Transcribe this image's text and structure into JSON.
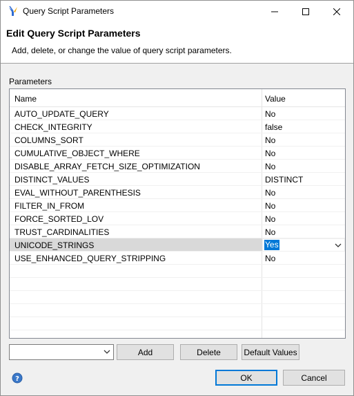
{
  "window": {
    "title": "Query Script Parameters",
    "icon": "app-logo-icon",
    "controls": [
      "minimize-icon",
      "maximize-icon",
      "close-icon"
    ]
  },
  "header": {
    "title": "Edit Query Script Parameters",
    "description": "Add, delete, or change the value of query script parameters."
  },
  "parameters": {
    "label": "Parameters",
    "columns": {
      "name": "Name",
      "value": "Value"
    },
    "rows": [
      {
        "name": "AUTO_UPDATE_QUERY",
        "value": "No"
      },
      {
        "name": "CHECK_INTEGRITY",
        "value": "false"
      },
      {
        "name": "COLUMNS_SORT",
        "value": "No"
      },
      {
        "name": "CUMULATIVE_OBJECT_WHERE",
        "value": "No"
      },
      {
        "name": "DISABLE_ARRAY_FETCH_SIZE_OPTIMIZATION",
        "value": "No"
      },
      {
        "name": "DISTINCT_VALUES",
        "value": "DISTINCT"
      },
      {
        "name": "EVAL_WITHOUT_PARENTHESIS",
        "value": "No"
      },
      {
        "name": "FILTER_IN_FROM",
        "value": "No"
      },
      {
        "name": "FORCE_SORTED_LOV",
        "value": "No"
      },
      {
        "name": "TRUST_CARDINALITIES",
        "value": "No"
      },
      {
        "name": "UNICODE_STRINGS",
        "value": "Yes",
        "selected": true
      },
      {
        "name": "USE_ENHANCED_QUERY_STRIPPING",
        "value": "No"
      }
    ]
  },
  "controls": {
    "parameter_combo_value": "",
    "add_label": "Add",
    "delete_label": "Delete",
    "default_values_label": "Default Values"
  },
  "footer": {
    "ok_label": "OK",
    "cancel_label": "Cancel",
    "help_icon": "help-icon"
  },
  "colors": {
    "selection": "#0078d7",
    "selected_row": "#d9d9d9",
    "button_face": "#e1e1e1"
  }
}
